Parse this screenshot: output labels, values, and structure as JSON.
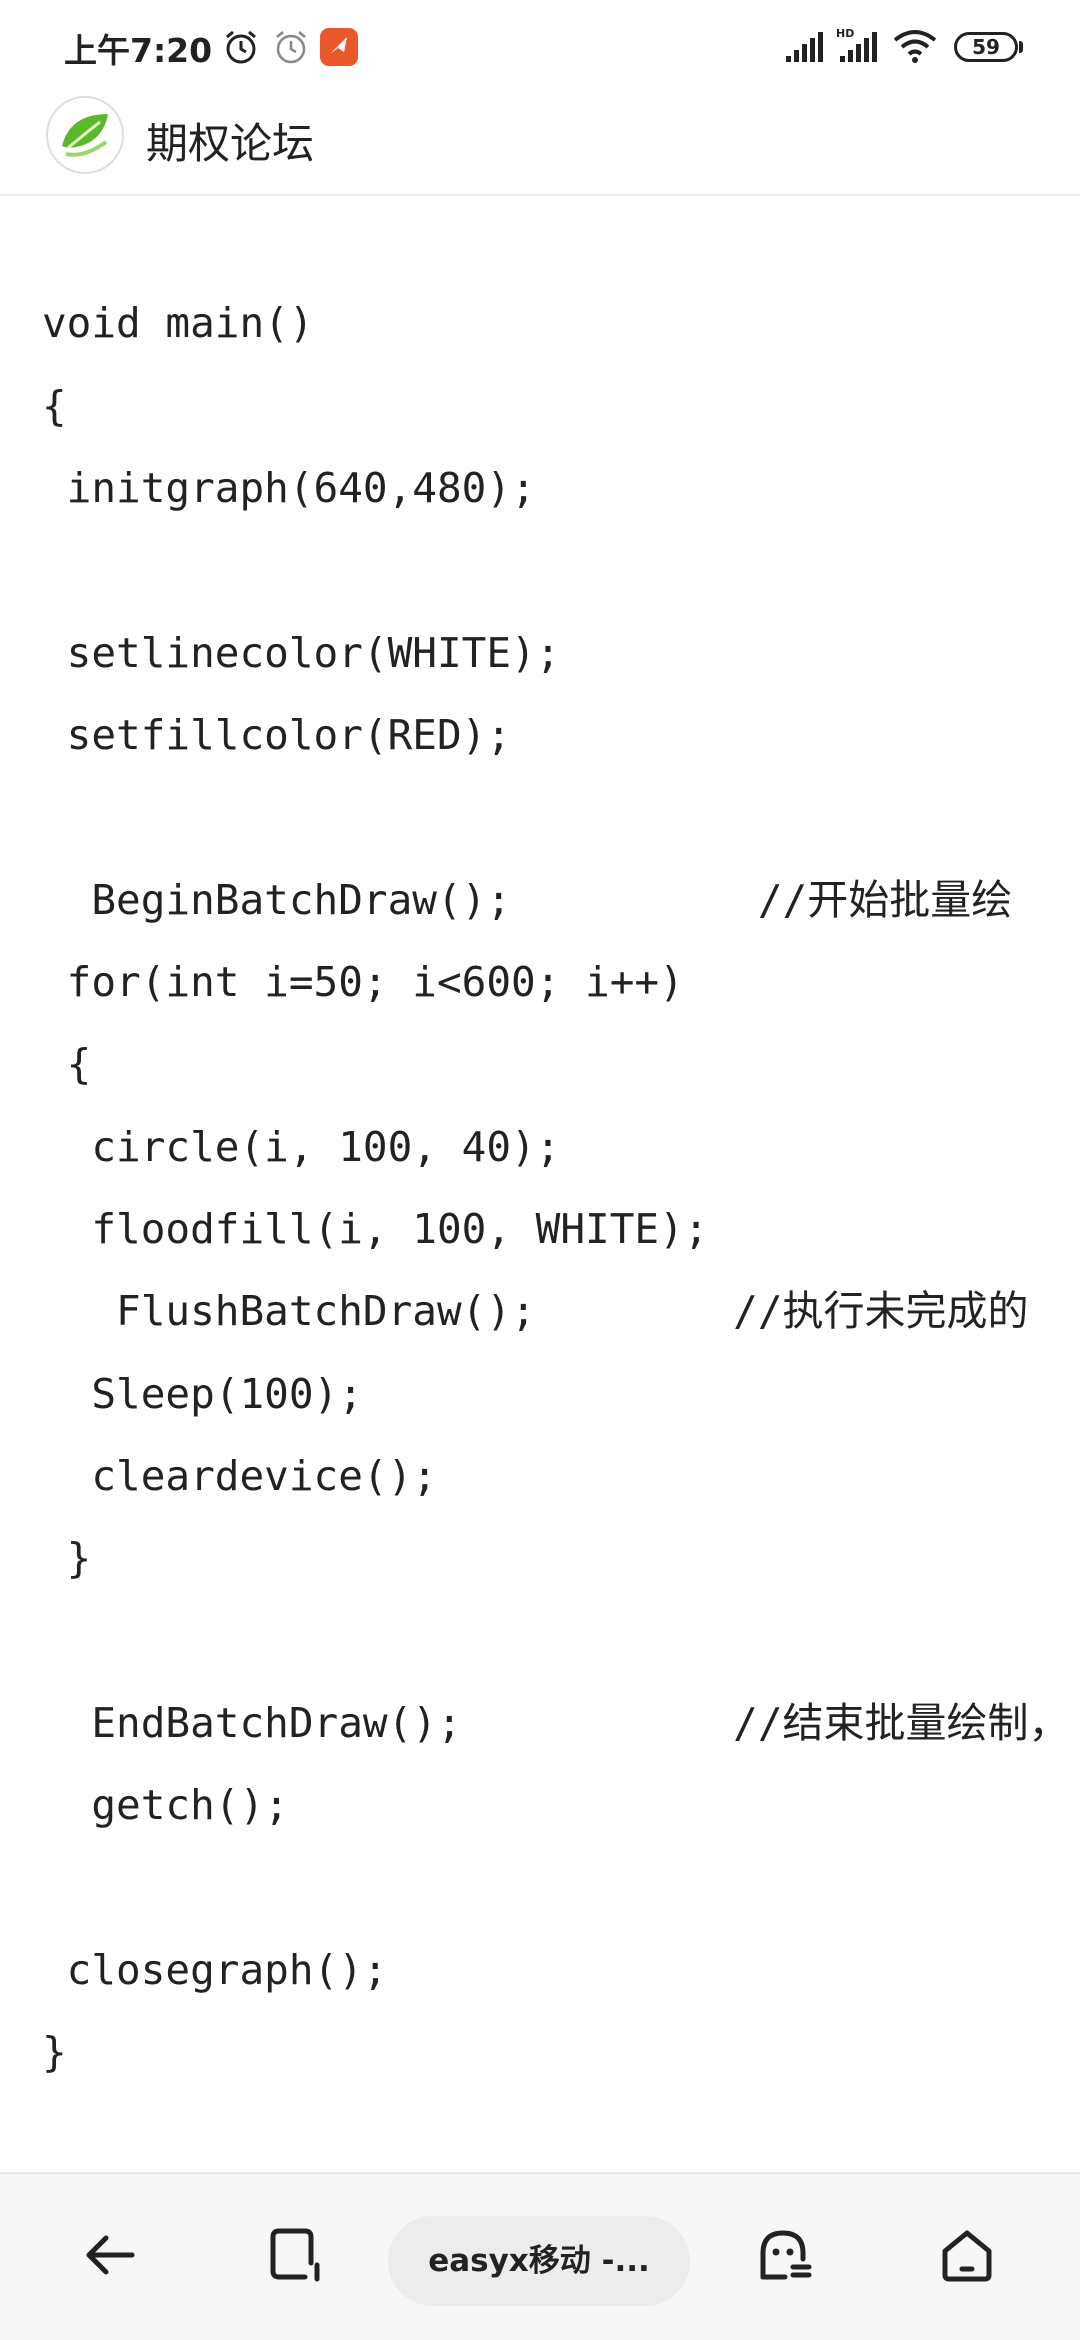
{
  "status_bar": {
    "time": "上午7:20",
    "battery": "59",
    "icons": [
      "alarm-icon",
      "alarm-clock-outline-icon",
      "notification-app-icon",
      "signal-icon",
      "hd-signal-icon",
      "wifi-icon",
      "battery-icon"
    ]
  },
  "header": {
    "title": "期权论坛",
    "logo_icon": "green-leaf-logo-icon"
  },
  "code_lines": [
    "void main()",
    "{",
    " initgraph(640,480);",
    "",
    " setlinecolor(WHITE);",
    " setfillcolor(RED);",
    "",
    "  BeginBatchDraw();          //开始批量绘",
    " for(int i=50; i<600; i++)",
    " {",
    "  circle(i, 100, 40);",
    "  floodfill(i, 100, WHITE);",
    "   FlushBatchDraw();        //执行未完成的",
    "  Sleep(100);",
    "  cleardevice();",
    " }",
    "",
    "  EndBatchDraw();           //结束批量绘制，",
    "  getch();",
    "",
    " closegraph();",
    "}"
  ],
  "bottom_nav": {
    "tab_label": "easyx移动 -...",
    "icons": [
      "back-arrow-icon",
      "tabs-icon",
      "assistant-face-icon",
      "home-icon"
    ]
  },
  "colors": {
    "accent_orange": "#e9572b",
    "logo_green": "#5cb82b",
    "text": "#222222",
    "background": "#ffffff"
  }
}
